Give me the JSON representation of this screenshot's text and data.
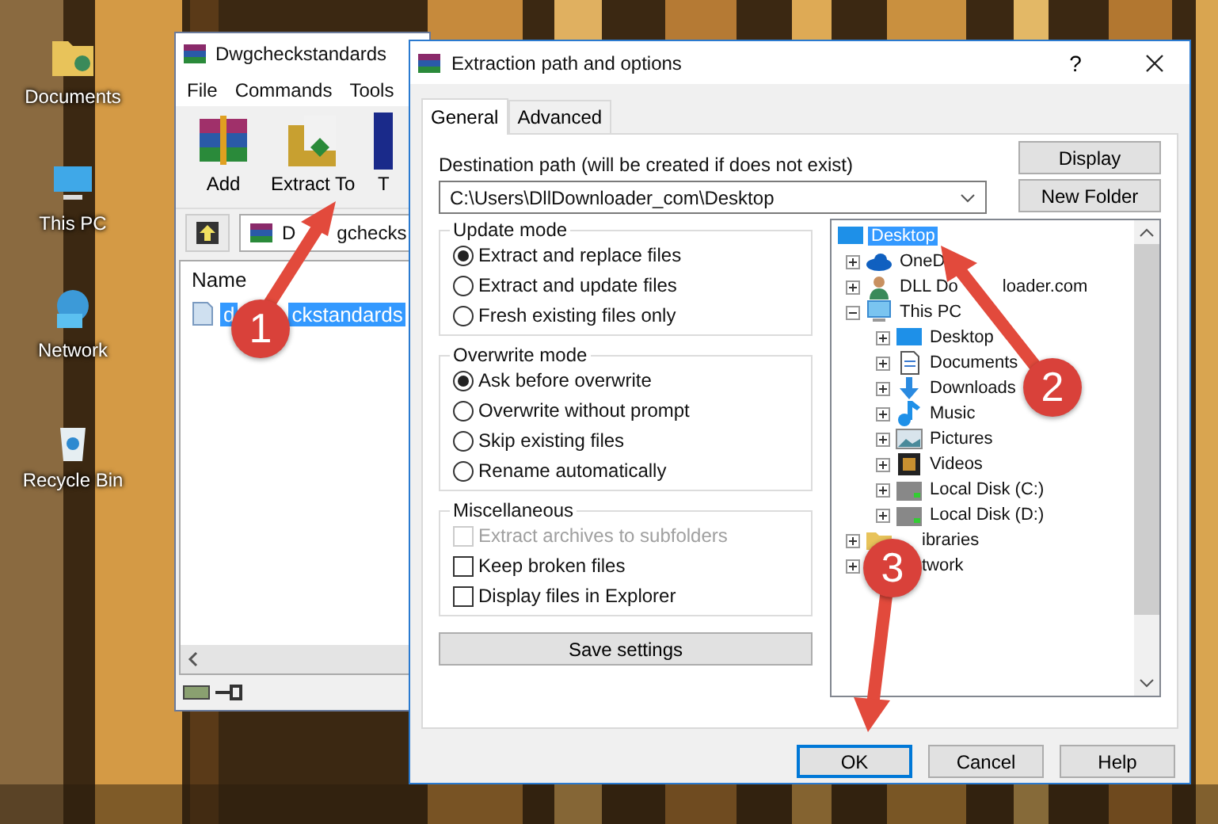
{
  "desktop_icons": [
    {
      "label": "Documents",
      "kind": "documents"
    },
    {
      "label": "This PC",
      "kind": "pc"
    },
    {
      "label": "Network",
      "kind": "network"
    },
    {
      "label": "Recycle Bin",
      "kind": "bin"
    }
  ],
  "archiver_window": {
    "title": "Dwgcheckstandards",
    "menu": [
      "File",
      "Commands",
      "Tools"
    ],
    "toolbar": [
      {
        "label": "Add",
        "kind": "add"
      },
      {
        "label": "Extract To",
        "kind": "extract"
      },
      {
        "label": "T",
        "kind": "test"
      }
    ],
    "address": "D",
    "address_tail": "gchecks",
    "columns": [
      "Name"
    ],
    "files": [
      {
        "name": "d",
        "name_tail": "ckstandards",
        "selected": true
      }
    ]
  },
  "dialog": {
    "title": "Extraction path and options",
    "help": "?",
    "tabs": [
      {
        "label": "General",
        "selected": true
      },
      {
        "label": "Advanced",
        "selected": false
      }
    ],
    "destination_label": "Destination path (will be created if does not exist)",
    "destination_path": "C:\\Users\\DllDownloader_com\\Desktop",
    "side_buttons": [
      "Display",
      "New Folder"
    ],
    "groups": [
      {
        "title": "Update mode",
        "options": [
          {
            "kind": "radio",
            "label": "Extract and replace files",
            "checked": true
          },
          {
            "kind": "radio",
            "label": "Extract and update files",
            "checked": false
          },
          {
            "kind": "radio",
            "label": "Fresh existing files only",
            "checked": false
          }
        ]
      },
      {
        "title": "Overwrite mode",
        "options": [
          {
            "kind": "radio",
            "label": "Ask before overwrite",
            "checked": true
          },
          {
            "kind": "radio",
            "label": "Overwrite without prompt",
            "checked": false
          },
          {
            "kind": "radio",
            "label": "Skip existing files",
            "checked": false
          },
          {
            "kind": "radio",
            "label": "Rename automatically",
            "checked": false
          }
        ]
      },
      {
        "title": "Miscellaneous",
        "options": [
          {
            "kind": "checkbox",
            "label": "Extract archives to subfolders",
            "checked": false,
            "disabled": true
          },
          {
            "kind": "checkbox",
            "label": "Keep broken files",
            "checked": false,
            "disabled": false
          },
          {
            "kind": "checkbox",
            "label": "Display files in Explorer",
            "checked": false,
            "disabled": false
          }
        ]
      }
    ],
    "save_button": "Save settings",
    "tree": [
      {
        "label": "Desktop",
        "kind": "desktop",
        "selected": true,
        "children": [
          {
            "label": "OneD",
            "kind": "cloud",
            "selected": false,
            "expanded": false
          },
          {
            "label": "DLL Do",
            "label_tail": "loader.com",
            "kind": "user",
            "selected": false,
            "expanded": false
          },
          {
            "label": "This PC",
            "kind": "pc",
            "selected": false,
            "expanded": true,
            "children": [
              {
                "label": "Desktop",
                "kind": "desktop",
                "selected": false,
                "expanded": false
              },
              {
                "label": "Documents",
                "kind": "docs",
                "selected": false,
                "expanded": false
              },
              {
                "label": "Downloads",
                "kind": "download",
                "selected": false,
                "expanded": false
              },
              {
                "label": "Music",
                "kind": "music",
                "selected": false,
                "expanded": false
              },
              {
                "label": "Pictures",
                "kind": "pictures",
                "selected": false,
                "expanded": false
              },
              {
                "label": "Videos",
                "kind": "videos",
                "selected": false,
                "expanded": false
              },
              {
                "label": "Local Disk (C:)",
                "kind": "disk",
                "selected": false,
                "expanded": false
              },
              {
                "label": "Local Disk (D:)",
                "kind": "disk",
                "selected": false,
                "expanded": false
              }
            ]
          },
          {
            "label": "ibraries",
            "kind": "library",
            "selected": false,
            "expanded": false
          },
          {
            "label": "twork",
            "kind": "covered",
            "selected": false,
            "expanded": false
          }
        ]
      }
    ],
    "buttons": [
      {
        "label": "OK",
        "default": true
      },
      {
        "label": "Cancel",
        "default": false
      },
      {
        "label": "Help",
        "default": false
      }
    ]
  },
  "annotations": [
    {
      "number": "1"
    },
    {
      "number": "2"
    },
    {
      "number": "3"
    }
  ]
}
